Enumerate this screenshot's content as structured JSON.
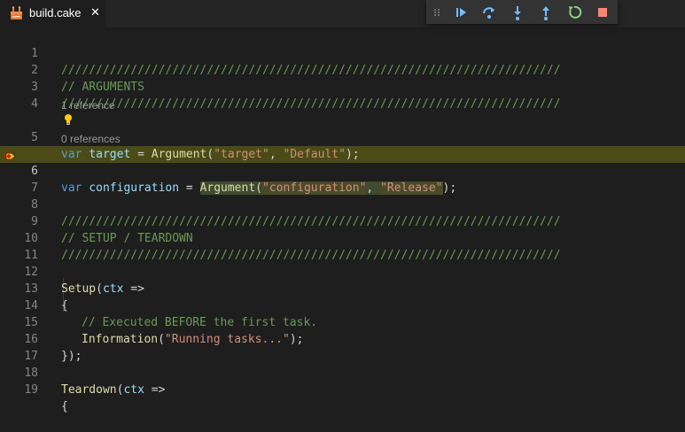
{
  "tab": {
    "label": "build.cake",
    "close": "✕"
  },
  "debug_toolbar": {
    "items": [
      "drag-grip",
      "continue",
      "step-over",
      "step-into",
      "step-out",
      "restart",
      "stop"
    ]
  },
  "colors": {
    "background": "#1e1e1e",
    "comment": "#6a9955",
    "keyword": "#569cd6",
    "variable": "#9cdcfe",
    "string": "#ce9178",
    "function": "#dcdcaa",
    "current_line": "#4b4b18"
  },
  "code_lens": {
    "line5": "1 reference",
    "line6": "0 references"
  },
  "active_line": "6",
  "lines": {
    "l1": {
      "num": "1",
      "comment": "////////////////////////////////////////////////////////////////////////"
    },
    "l2": {
      "num": "2",
      "comment": "// ARGUMENTS"
    },
    "l3": {
      "num": "3",
      "comment": "////////////////////////////////////////////////////////////////////////"
    },
    "l4": {
      "num": "4"
    },
    "l5": {
      "num": "5",
      "kw": "var",
      "name": "target",
      "eq": " = ",
      "fn": "Argument",
      "open": "(",
      "s1": "\"target\"",
      "comma": ", ",
      "s2": "\"Default\"",
      "close": ");"
    },
    "l6": {
      "num": "6",
      "kw": "var",
      "name": "configuration",
      "eq": " = ",
      "fn": "Argument",
      "open": "(",
      "s1": "\"configuration\"",
      "comma": ", ",
      "s2": "\"Release\"",
      "close": ");"
    },
    "l7": {
      "num": "7"
    },
    "l8": {
      "num": "8",
      "comment": "////////////////////////////////////////////////////////////////////////"
    },
    "l9": {
      "num": "9",
      "comment": "// SETUP / TEARDOWN"
    },
    "l10": {
      "num": "10",
      "comment": "////////////////////////////////////////////////////////////////////////"
    },
    "l11": {
      "num": "11"
    },
    "l12": {
      "num": "12",
      "fn": "Setup",
      "open": "(",
      "var": "ctx",
      "rest": " =>"
    },
    "l13": {
      "num": "13",
      "text": "{"
    },
    "l14": {
      "num": "14",
      "comment": "// Executed BEFORE the first task."
    },
    "l15": {
      "num": "15",
      "fn": "Information",
      "open": "(",
      "str": "\"Running tasks...\"",
      "close": ");"
    },
    "l16": {
      "num": "16",
      "text": "});"
    },
    "l17": {
      "num": "17"
    },
    "l18": {
      "num": "18",
      "fn": "Teardown",
      "open": "(",
      "var": "ctx",
      "rest": " =>"
    },
    "l19": {
      "num": "19",
      "text": "{"
    }
  }
}
